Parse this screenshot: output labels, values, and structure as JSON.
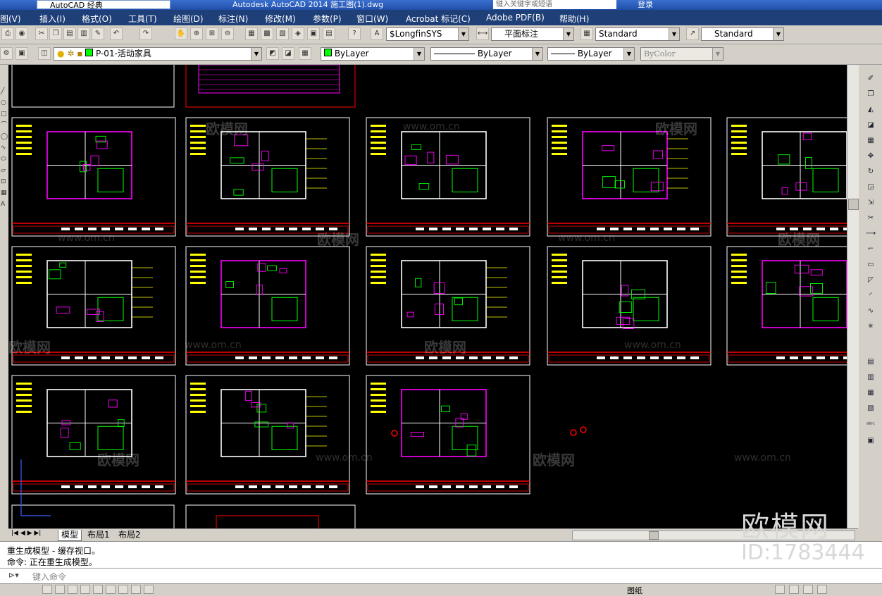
{
  "titlebar": {
    "workspace": "AutoCAD 经典",
    "title": "Autodesk AutoCAD 2014    施工图(1).dwg",
    "search_placeholder": "键入关键字或短语",
    "login": "登录"
  },
  "menu": [
    "图(V)",
    "插入(I)",
    "格式(O)",
    "工具(T)",
    "绘图(D)",
    "标注(N)",
    "修改(M)",
    "参数(P)",
    "窗口(W)",
    "Acrobat 标记(C)",
    "Adobe PDF(B)",
    "帮助(H)"
  ],
  "toolbar1": {
    "text_style": "$LongfinSYS",
    "dim_style": "平面标注",
    "table_style": "Standard",
    "multileader_style": "Standard"
  },
  "toolbar2": {
    "layer": "P-01-活动家具",
    "color": "ByLayer",
    "linetype": "ByLayer",
    "lineweight": "ByLayer",
    "plotstyle": "ByColor"
  },
  "tabs": [
    "模型",
    "布局1",
    "布局2"
  ],
  "command_history": [
    "重生成模型 - 缓存视口。",
    "命令: 正在重生成模型。"
  ],
  "command_placeholder": "键入命令",
  "status": {
    "paper": "图纸"
  },
  "watermark": {
    "site": "www.om.cn",
    "brand": "欧模网",
    "id": "ID:1783444"
  },
  "colors": {
    "canvas": "#000000",
    "frame": "#ffffff",
    "titleblock": "#ff0000",
    "wall": "#ff00ff",
    "furniture": "#00ff00",
    "label": "#ffff00",
    "menubar": "#1e3f78"
  }
}
